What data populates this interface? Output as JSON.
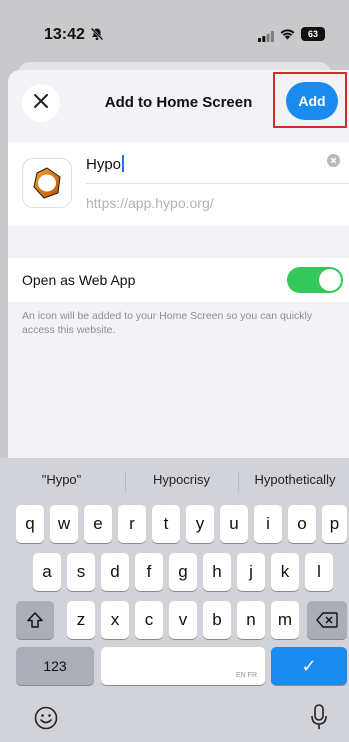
{
  "status": {
    "time": "13:42",
    "battery": "63"
  },
  "header": {
    "close_label": "×",
    "title": "Add to Home Screen",
    "add_label": "Add"
  },
  "name_field": {
    "value": "Hypo",
    "url": "https://app.hypo.org/"
  },
  "web_app": {
    "label": "Open as Web App",
    "enabled": true,
    "note": "An icon will be added to your Home Screen so you can quickly access this website."
  },
  "keyboard": {
    "suggestions": [
      "\"Hypo\"",
      "Hypocrisy",
      "Hypothetically"
    ],
    "row1": [
      "q",
      "w",
      "e",
      "r",
      "t",
      "y",
      "u",
      "i",
      "o",
      "p"
    ],
    "row2": [
      "a",
      "s",
      "d",
      "f",
      "g",
      "h",
      "j",
      "k",
      "l"
    ],
    "row3": [
      "z",
      "x",
      "c",
      "v",
      "b",
      "n",
      "m"
    ],
    "numbers_label": "123",
    "space_lang": "EN FR",
    "return_label": "✓"
  },
  "colors": {
    "accent": "#1a8cf0",
    "toggle_on": "#34c759",
    "highlight": "#d62a2a"
  }
}
